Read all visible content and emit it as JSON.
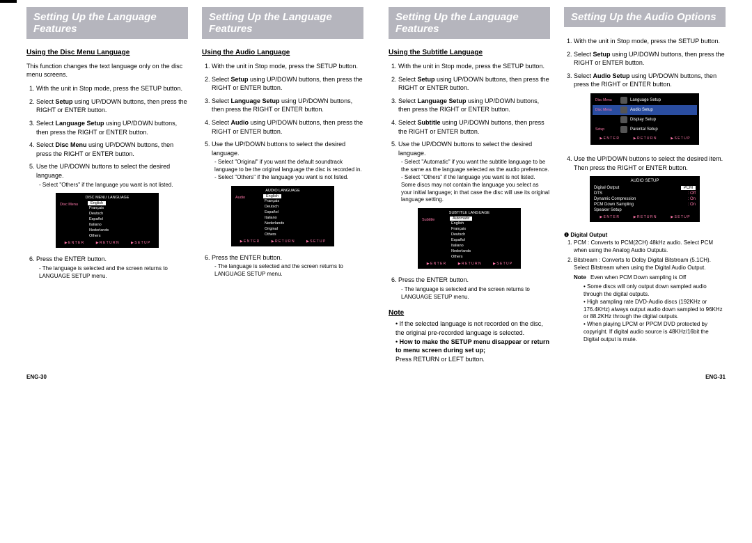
{
  "headers": {
    "lang": "Setting Up the Language Features",
    "audio": "Setting Up the Audio Options"
  },
  "disc": {
    "title": "Using the Disc Menu Language",
    "intro": "This function changes the text language only on the disc menu screens.",
    "s1": "With the unit in Stop mode, press the SETUP button.",
    "s2a": "Select ",
    "s2b": "Setup",
    "s2c": " using UP/DOWN buttons, then press the RIGHT or ENTER button.",
    "s3a": "Select ",
    "s3b": "Language Setup",
    "s3c": " using UP/DOWN buttons, then press the RIGHT or ENTER button.",
    "s4a": "Select ",
    "s4b": "Disc Menu",
    "s4c": " using UP/DOWN buttons, then press the RIGHT or ENTER button.",
    "s5": "Use the UP/DOWN buttons to select the desired language.",
    "s5_note": "Select \"Others\" if the language you want is not listed.",
    "s6": "Press the ENTER button.",
    "s6_note": "The language is selected and the screen returns to LANGUAGE SETUP menu.",
    "shot": {
      "title": "DISC MENU LANGUAGE",
      "label": "Disc Menu",
      "opts": [
        "English",
        "Français",
        "Deutsch",
        "Español",
        "Italiano",
        "Nederlands",
        "Others"
      ],
      "footer": [
        "▶ E N T E R",
        "▶ R E T U R N",
        "▶ S E T U P"
      ]
    }
  },
  "audioLang": {
    "title": "Using the Audio Language",
    "s1": "With the unit in Stop mode, press the SETUP button.",
    "s2a": "Select ",
    "s2b": "Setup",
    "s2c": " using UP/DOWN buttons, then press the RIGHT or ENTER button.",
    "s3a": "Select ",
    "s3b": "Language Setup",
    "s3c": " using UP/DOWN buttons, then press the RIGHT or ENTER button.",
    "s4a": "Select ",
    "s4b": "Audio",
    "s4c": " using UP/DOWN buttons, then press the RIGHT or ENTER button.",
    "s5": "Use the UP/DOWN buttons to select the desired language.",
    "s5_note1": "Select \"Original\" if you want the default soundtrack language to be the original language the disc is recorded in.",
    "s5_note2": "Select \"Others\" if the language you want is not listed.",
    "s6": "Press the ENTER button.",
    "s6_note": "The language is selected and the screen returns to LANGUAGE SETUP menu.",
    "shot": {
      "title": "AUDIO LANGUAGE",
      "label": "Audio",
      "opts": [
        "English",
        "Français",
        "Deutsch",
        "Español",
        "Italiano",
        "Nederlands",
        "Original",
        "Others"
      ],
      "footer": [
        "▶ E N T E R",
        "▶ R E T U R N",
        "▶ S E T U P"
      ]
    }
  },
  "subtitle": {
    "title": "Using the Subtitle Language",
    "s1": "With the unit in Stop mode, press the SETUP button.",
    "s2a": "Select ",
    "s2b": "Setup",
    "s2c": " using UP/DOWN buttons, then press the RIGHT or ENTER button.",
    "s3a": "Select ",
    "s3b": "Language Setup",
    "s3c": " using UP/DOWN buttons, then press the RIGHT or ENTER button.",
    "s4a": "Select ",
    "s4b": "Subtitle",
    "s4c": " using UP/DOWN buttons, then press the RIGHT or ENTER button.",
    "s5": "Use the UP/DOWN buttons to select the desired language.",
    "s5_note1": "Select \"Automatic\" if you want the subtitle language to be the same as the language selected as the audio preference.",
    "s5_note2": "Select \"Others\" if the language you want is not listed. Some discs may not contain the language you select as your initial language; in that case the disc will use its original language setting.",
    "s6": "Press the ENTER button.",
    "s6_note": "The language is selected and the screen returns to LANGUAGE SETUP menu.",
    "note_head": "Note",
    "note1": "If the selected language is not recorded on the disc, the original pre-recorded language is selected.",
    "note2_bold": "How to make the SETUP menu disappear or return to menu screen during set up;",
    "note2_rest": "Press RETURN or LEFT button.",
    "shot": {
      "title": "SUBTITLE LANGUAGE",
      "label": "Subtitle",
      "opts": [
        "Automatic",
        "English",
        "Français",
        "Deutsch",
        "Español",
        "Italiano",
        "Nederlands",
        "Others"
      ],
      "footer": [
        "▶ E N T E R",
        "▶ R E T U R N",
        "▶ S E T U P"
      ]
    }
  },
  "audioOpt": {
    "s1": "With the unit in Stop mode, press the SETUP button.",
    "s2a": "Select ",
    "s2b": "Setup",
    "s2c": " using UP/DOWN buttons, then press the RIGHT or ENTER button.",
    "s3a": "Select ",
    "s3b": "Audio Setup",
    "s3c": " using UP/DOWN buttons, then press the RIGHT or ENTER button.",
    "s4": "Use the UP/DOWN buttons to select the desired item. Then press the RIGHT or ENTER button.",
    "setupShot": {
      "sideLabels": [
        "Disc Menu",
        "Disc Menu",
        "",
        "Setup"
      ],
      "items": [
        "Language Setup",
        "Audio Setup",
        "Display Setup",
        "Parental Setup"
      ],
      "footer": [
        "▶ E N T E R",
        "▶ R E T U R N",
        "▶ S E T U P"
      ]
    },
    "audioShot": {
      "title": "AUDIO SETUP",
      "rows": [
        {
          "k": "Digital Output",
          "v": "PCM",
          "sel": true
        },
        {
          "k": "DTS",
          "v": ": Off"
        },
        {
          "k": "Dynamic Compression",
          "v": ": On"
        },
        {
          "k": "PCM Down Sampling",
          "v": ": On"
        },
        {
          "k": "Speaker Setup",
          "v": ""
        }
      ],
      "footer": [
        "▶ E N T E R",
        "▶ R E T U R N",
        "▶ S E T U P"
      ]
    },
    "digital_label": "❶ Digital Output",
    "do1": "PCM : Converts to PCM(2CH) 48kHz audio. Select PCM when using the Analog Audio Outputs.",
    "do2": "Bitstream : Converts to Dolby Digital Bitstream (5.1CH). Select Bitstream when using the Digital Audio Output.",
    "do_note_lbl": "Note",
    "do_note_lead": "Even when PCM Down sampling is Off",
    "do_b1": "Some discs will only output down sampled audio through the digital outputs.",
    "do_b2": "High sampling rate DVD-Audio discs (192KHz or 176.4KHz) always output audio down sampled to 96KHz or 88.2KHz through the digital outputs.",
    "do_b3": "When playing LPCM or PPCM DVD protected by copyright. If digital audio source is 48KHz/16bit the Digital output is mute."
  },
  "pgnum": {
    "left": "ENG-30",
    "right": "ENG-31"
  }
}
